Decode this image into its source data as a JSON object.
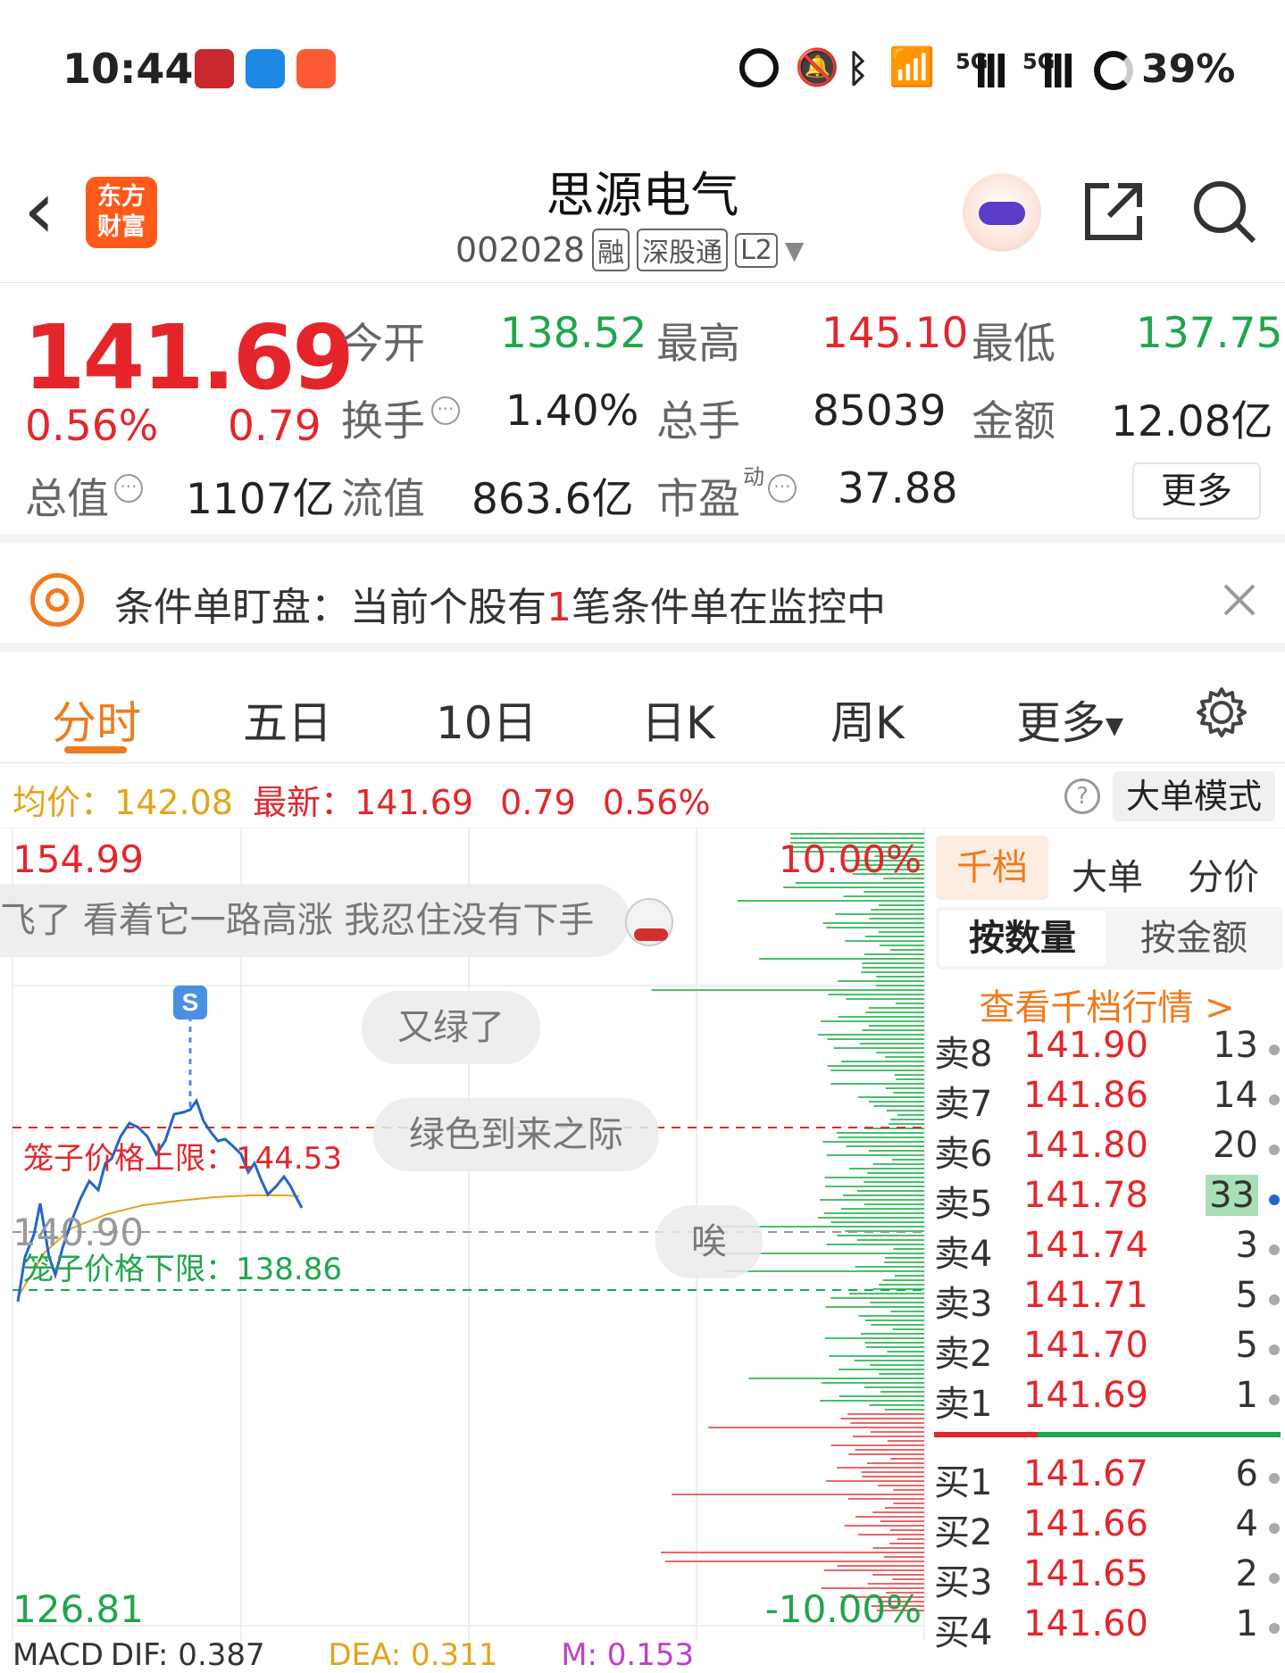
{
  "status": {
    "time": "10:44",
    "battery": "39%",
    "net1": "5G",
    "net2": "5G"
  },
  "header": {
    "back": "‹",
    "logo_line1": "东方",
    "logo_line2": "财富",
    "title": "思源电气",
    "code": "002028",
    "tags": [
      "融",
      "深股通",
      "L2"
    ]
  },
  "quote": {
    "price": "141.69",
    "pct": "0.56%",
    "chg": "0.79",
    "open_label": "今开",
    "open": "138.52",
    "high_label": "最高",
    "high": "145.10",
    "low_label": "最低",
    "low": "137.75",
    "turnover_label": "换手",
    "turnover": "1.40%",
    "vol_label": "总手",
    "vol": "85039",
    "amount_label": "金额",
    "amount": "12.08亿",
    "mcap_label": "总值",
    "mcap": "1107亿",
    "float_label": "流值",
    "float": "863.6亿",
    "pe_label": "市盈",
    "pe_sup": "动",
    "pe": "37.88",
    "more": "更多"
  },
  "banner": {
    "prefix": "条件单盯盘：当前个股有",
    "count": "1",
    "suffix": "笔条件单在监控中"
  },
  "tabs": [
    "分时",
    "五日",
    "10日",
    "日K",
    "周K",
    "更多"
  ],
  "info": {
    "avg_label": "均价：",
    "avg": "142.08",
    "last_label": "最新：",
    "last": "141.69",
    "chg": "0.79",
    "pct": "0.56%",
    "mode": "大单模式"
  },
  "chart": {
    "ymax": "154.99",
    "ymin": "126.81",
    "pmax": "10.00%",
    "pmin": "-10.00%",
    "base": "140.90",
    "upper_label": "笼子价格上限：",
    "upper": "144.53",
    "lower_label": "笼子价格下限：",
    "lower": "138.86",
    "signal": "S",
    "macd": "MACD",
    "dif": "DIF: 0.387",
    "dea": "DEA: 0.311",
    "m": "M: 0.153",
    "bubbles": [
      "飞了 看着它一路高涨 我忍住没有下手",
      "又绿了",
      "绿色到来之际",
      "唉"
    ]
  },
  "book": {
    "tabs": [
      "千档",
      "大单",
      "分价"
    ],
    "sub": [
      "按数量",
      "按金额"
    ],
    "link": "查看千档行情 >",
    "asks": [
      {
        "l": "卖8",
        "p": "141.90",
        "v": "13"
      },
      {
        "l": "卖7",
        "p": "141.86",
        "v": "14"
      },
      {
        "l": "卖6",
        "p": "141.80",
        "v": "20"
      },
      {
        "l": "卖5",
        "p": "141.78",
        "v": "33"
      },
      {
        "l": "卖4",
        "p": "141.74",
        "v": "3"
      },
      {
        "l": "卖3",
        "p": "141.71",
        "v": "5"
      },
      {
        "l": "卖2",
        "p": "141.70",
        "v": "5"
      },
      {
        "l": "卖1",
        "p": "141.69",
        "v": "1"
      }
    ],
    "bids": [
      {
        "l": "买1",
        "p": "141.67",
        "v": "6"
      },
      {
        "l": "买2",
        "p": "141.66",
        "v": "4"
      },
      {
        "l": "买3",
        "p": "141.65",
        "v": "2"
      },
      {
        "l": "买4",
        "p": "141.60",
        "v": "1"
      }
    ]
  },
  "colors": {
    "red": "#e4262b",
    "green": "#1ea64b",
    "orange": "#f07a1e",
    "blue": "#2266c9"
  }
}
